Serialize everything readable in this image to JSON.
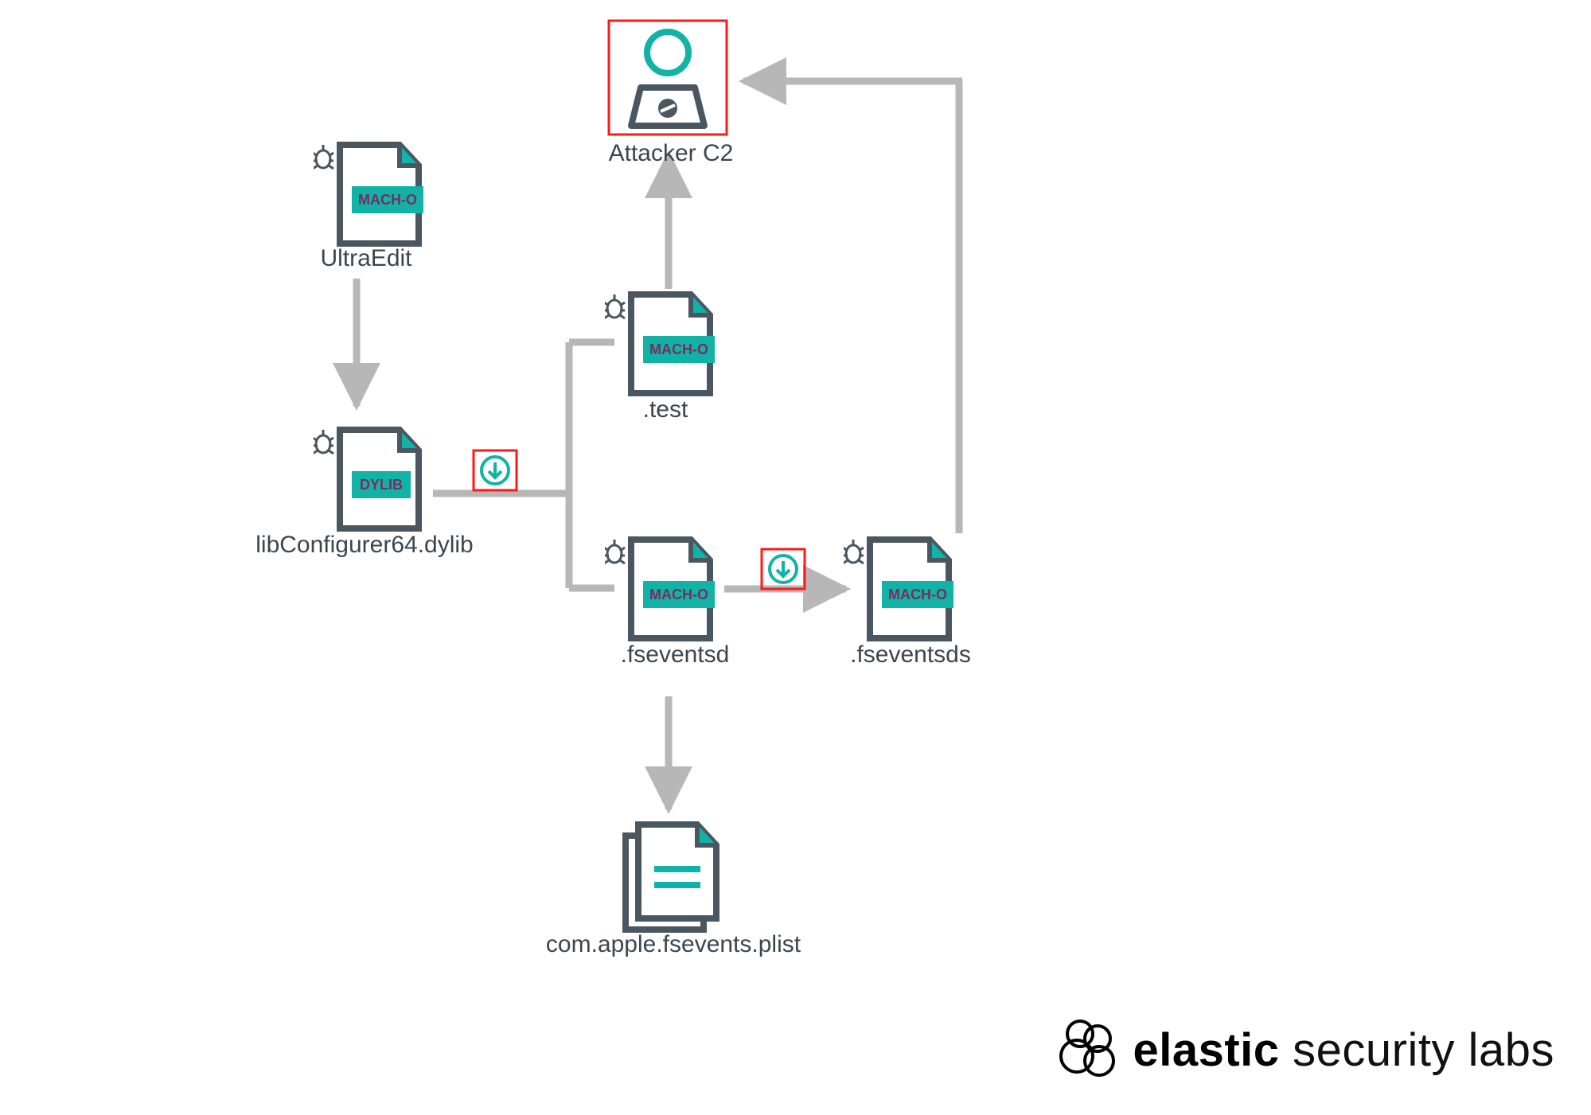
{
  "nodes": {
    "attacker": {
      "label": "Attacker C2"
    },
    "ultraedit": {
      "label": "UltraEdit",
      "badge": "MACH-O"
    },
    "libconfigurer": {
      "label": "libConfigurer64.dylib",
      "badge": "DYLIB"
    },
    "test": {
      "label": ".test",
      "badge": "MACH-O"
    },
    "fseventsd": {
      "label": ".fseventsd",
      "badge": "MACH-O"
    },
    "fseventsds": {
      "label": ".fseventsds",
      "badge": "MACH-O"
    },
    "plist": {
      "label": "com.apple.fsevents.plist"
    }
  },
  "brand": {
    "bold": "elastic",
    "thin": "security labs"
  }
}
